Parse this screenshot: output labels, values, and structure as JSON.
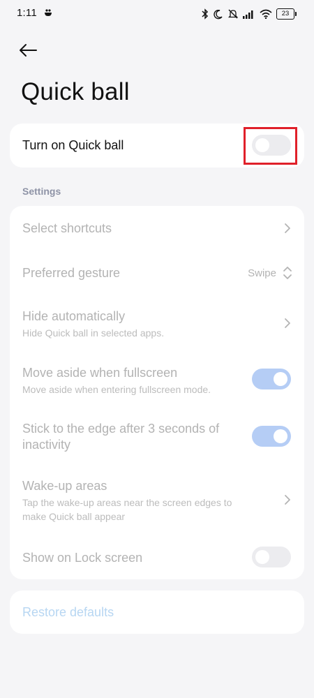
{
  "status_bar": {
    "time": "1:11",
    "battery": "23",
    "icons": [
      "app-notification-icon",
      "bluetooth-icon",
      "moon-icon",
      "silent-bell-icon",
      "signal-icon",
      "wifi-icon",
      "battery-icon"
    ]
  },
  "header": {
    "back_icon": "back-arrow-icon",
    "title": "Quick ball"
  },
  "main_toggle": {
    "label": "Turn on Quick ball",
    "state": "off",
    "highlight_color": "#e0202a"
  },
  "settings": {
    "header": "Settings",
    "items": [
      {
        "title": "Select shortcuts",
        "control": "chevron"
      },
      {
        "title": "Preferred gesture",
        "value": "Swipe",
        "control": "dropdown"
      },
      {
        "title": "Hide automatically",
        "subtitle": "Hide Quick ball in selected apps.",
        "control": "chevron"
      },
      {
        "title": "Move aside when fullscreen",
        "subtitle": "Move aside when entering fullscreen mode.",
        "control": "toggle",
        "state": "on"
      },
      {
        "title_line1": "Stick to the edge after 3 seconds of",
        "title_line2": "inactivity",
        "control": "toggle",
        "state": "on"
      },
      {
        "title": "Wake-up areas",
        "subtitle_line1": "Tap the wake-up areas near the screen edges to",
        "subtitle_line2": "make Quick ball appear",
        "control": "chevron"
      },
      {
        "title": "Show on Lock screen",
        "control": "toggle",
        "state": "off"
      }
    ]
  },
  "restore": {
    "label": "Restore defaults"
  },
  "colors": {
    "background": "#f5f5f7",
    "card": "#ffffff",
    "toggle_on": "#b5cdf5",
    "toggle_off": "#ececef",
    "restore_text": "#b7d6f2"
  }
}
